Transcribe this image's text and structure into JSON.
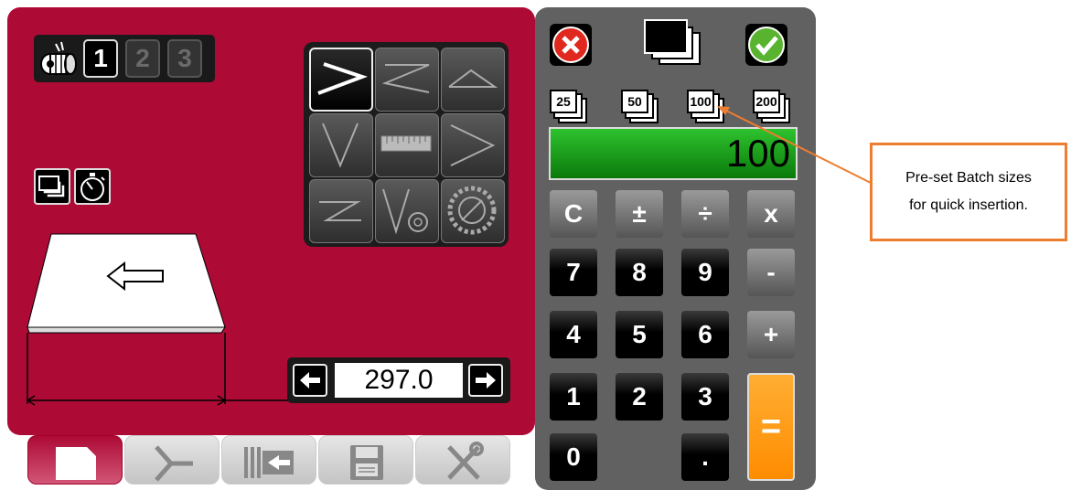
{
  "tool_selector": {
    "tools": [
      "1",
      "2",
      "3"
    ],
    "active_tool": "1"
  },
  "position": {
    "value": "297.0"
  },
  "tabs": [
    {
      "name": "program",
      "active": true
    },
    {
      "name": "bend",
      "active": false
    },
    {
      "name": "backgauge",
      "active": false
    },
    {
      "name": "save",
      "active": false
    },
    {
      "name": "settings",
      "active": false
    }
  ],
  "calculator": {
    "display": "100",
    "batch_presets": [
      "25",
      "50",
      "100",
      "200"
    ],
    "keys": {
      "clear": "C",
      "plusminus": "±",
      "divide": "÷",
      "multiply": "x",
      "seven": "7",
      "eight": "8",
      "nine": "9",
      "minus": "-",
      "four": "4",
      "five": "5",
      "six": "6",
      "plus": "+",
      "one": "1",
      "two": "2",
      "three": "3",
      "equals": "=",
      "zero": "0",
      "dot": "."
    }
  },
  "callout": {
    "line1": "Pre-set Batch sizes",
    "line2": "for quick insertion."
  },
  "colors": {
    "panel": "#ad0a35",
    "calc": "#616161",
    "display": "#1fa51f",
    "accent": "#ff8c00",
    "callout": "#ed7d31"
  }
}
